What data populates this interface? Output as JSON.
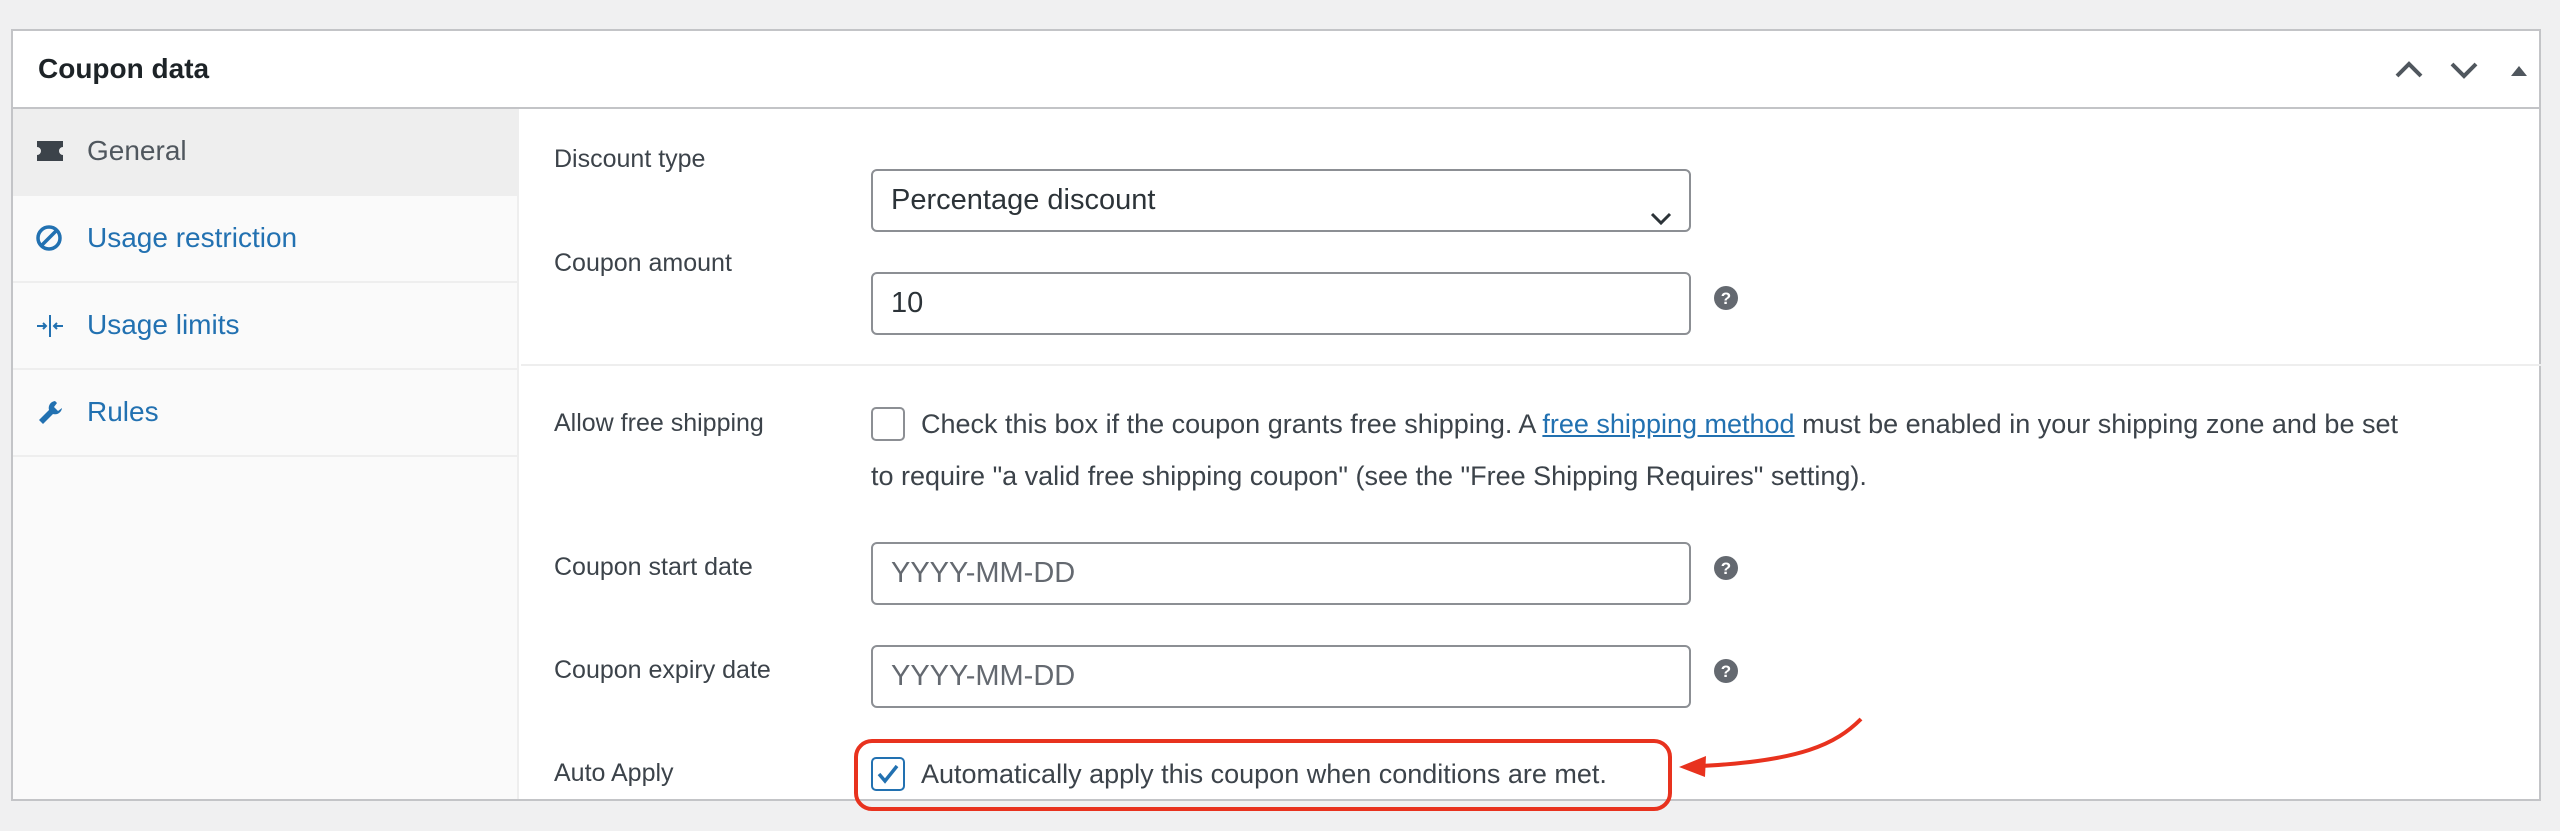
{
  "panel": {
    "title": "Coupon data"
  },
  "header_controls": [
    {
      "name": "move-up",
      "icon": "chevron-up-icon"
    },
    {
      "name": "move-down",
      "icon": "chevron-down-icon"
    },
    {
      "name": "toggle-panel",
      "icon": "triangle-up-icon"
    }
  ],
  "tabs": [
    {
      "label": "General",
      "icon": "ticket-icon",
      "active": true
    },
    {
      "label": "Usage restriction",
      "icon": "no-entry-icon",
      "active": false
    },
    {
      "label": "Usage limits",
      "icon": "arrows-in-icon",
      "active": false
    },
    {
      "label": "Rules",
      "icon": "wrench-icon",
      "active": false
    }
  ],
  "fields": {
    "discount_type": {
      "label": "Discount type",
      "value": "Percentage discount"
    },
    "coupon_amount": {
      "label": "Coupon amount",
      "value": "10"
    },
    "free_shipping": {
      "label": "Allow free shipping",
      "checked": false,
      "text_before": "Check this box if the coupon grants free shipping. A ",
      "link": "free shipping method",
      "text_after": " must be enabled in your shipping zone and be set",
      "line2": "to require \"a valid free shipping coupon\" (see the \"Free Shipping Requires\" setting)."
    },
    "start_date": {
      "label": "Coupon start date",
      "placeholder": "YYYY-MM-DD"
    },
    "expiry_date": {
      "label": "Coupon expiry date",
      "placeholder": "YYYY-MM-DD"
    },
    "auto_apply": {
      "label": "Auto Apply",
      "checked": true,
      "text": "Automatically apply this coupon when conditions are met."
    }
  },
  "colors": {
    "accent": "#2271b1",
    "annotation": "#e8321e",
    "border": "#c3c4c7"
  }
}
